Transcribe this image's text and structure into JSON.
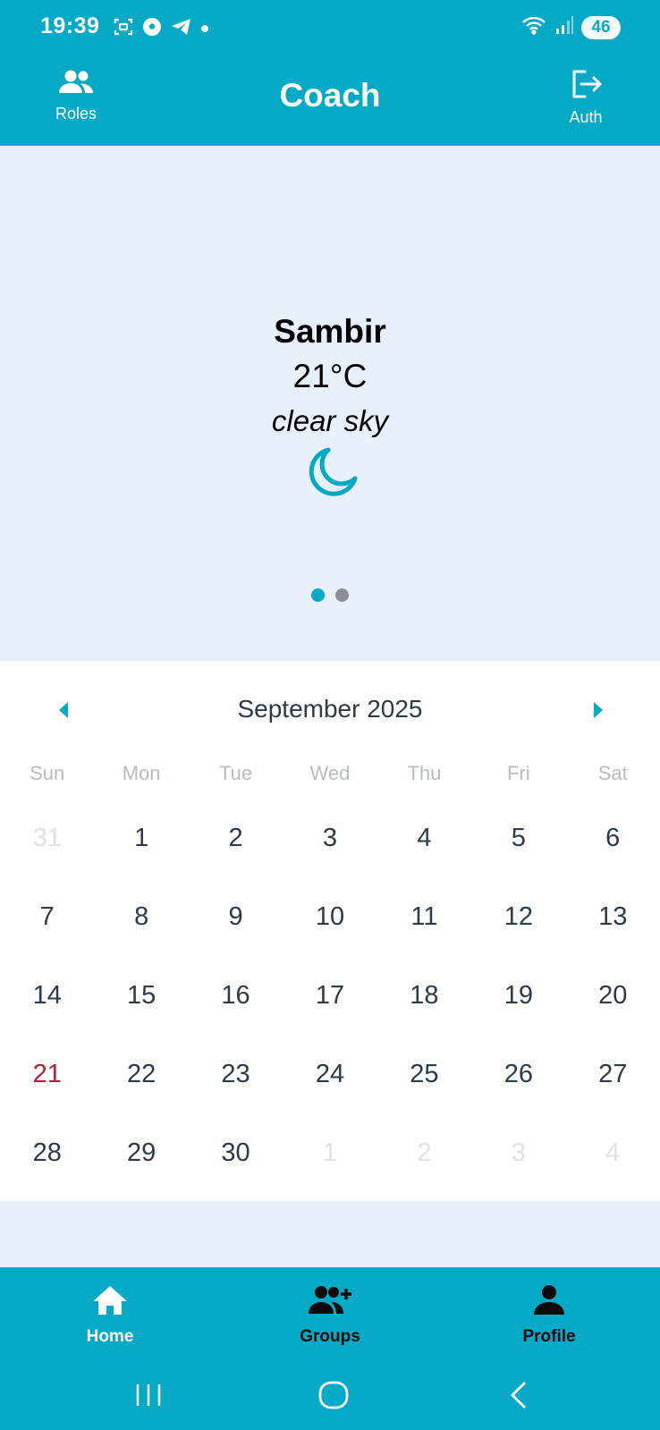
{
  "status_bar": {
    "time": "19:39",
    "battery": "46",
    "left_icons": [
      "screenshot-icon",
      "soccer-ball-icon",
      "telegram-icon",
      "notification-dot-icon"
    ],
    "right_icons": [
      "wifi-icon",
      "signal-icon",
      "battery-icon"
    ]
  },
  "header": {
    "title": "Coach",
    "left_button_label": "Roles",
    "left_button_icon": "people-icon",
    "right_button_label": "Auth",
    "right_button_icon": "logout-icon"
  },
  "weather": {
    "city": "Sambir",
    "temperature": "21°C",
    "description": "clear sky",
    "icon": "moon-icon",
    "pager": {
      "pages": 2,
      "active": 0
    }
  },
  "calendar": {
    "month_label": "September 2025",
    "weekdays": [
      "Sun",
      "Mon",
      "Tue",
      "Wed",
      "Thu",
      "Fri",
      "Sat"
    ],
    "weeks": [
      [
        {
          "d": "31",
          "other": true
        },
        {
          "d": "1"
        },
        {
          "d": "2"
        },
        {
          "d": "3"
        },
        {
          "d": "4"
        },
        {
          "d": "5"
        },
        {
          "d": "6"
        }
      ],
      [
        {
          "d": "7"
        },
        {
          "d": "8"
        },
        {
          "d": "9"
        },
        {
          "d": "10"
        },
        {
          "d": "11"
        },
        {
          "d": "12"
        },
        {
          "d": "13"
        }
      ],
      [
        {
          "d": "14"
        },
        {
          "d": "15"
        },
        {
          "d": "16"
        },
        {
          "d": "17"
        },
        {
          "d": "18"
        },
        {
          "d": "19"
        },
        {
          "d": "20"
        }
      ],
      [
        {
          "d": "21",
          "today": true
        },
        {
          "d": "22"
        },
        {
          "d": "23"
        },
        {
          "d": "24"
        },
        {
          "d": "25"
        },
        {
          "d": "26"
        },
        {
          "d": "27"
        }
      ],
      [
        {
          "d": "28"
        },
        {
          "d": "29"
        },
        {
          "d": "30"
        },
        {
          "d": "1",
          "other": true
        },
        {
          "d": "2",
          "other": true
        },
        {
          "d": "3",
          "other": true
        },
        {
          "d": "4",
          "other": true
        }
      ]
    ]
  },
  "bottom_nav": {
    "items": [
      {
        "label": "Home",
        "icon": "home-icon",
        "active": true
      },
      {
        "label": "Groups",
        "icon": "add-group-icon",
        "active": false
      },
      {
        "label": "Profile",
        "icon": "person-icon",
        "active": false
      }
    ]
  },
  "colors": {
    "primary": "#03a9c5",
    "background": "#e8f0fd",
    "today": "#b52130",
    "text_dark": "#2d3a48",
    "inactive_dot": "#8e8e96"
  }
}
